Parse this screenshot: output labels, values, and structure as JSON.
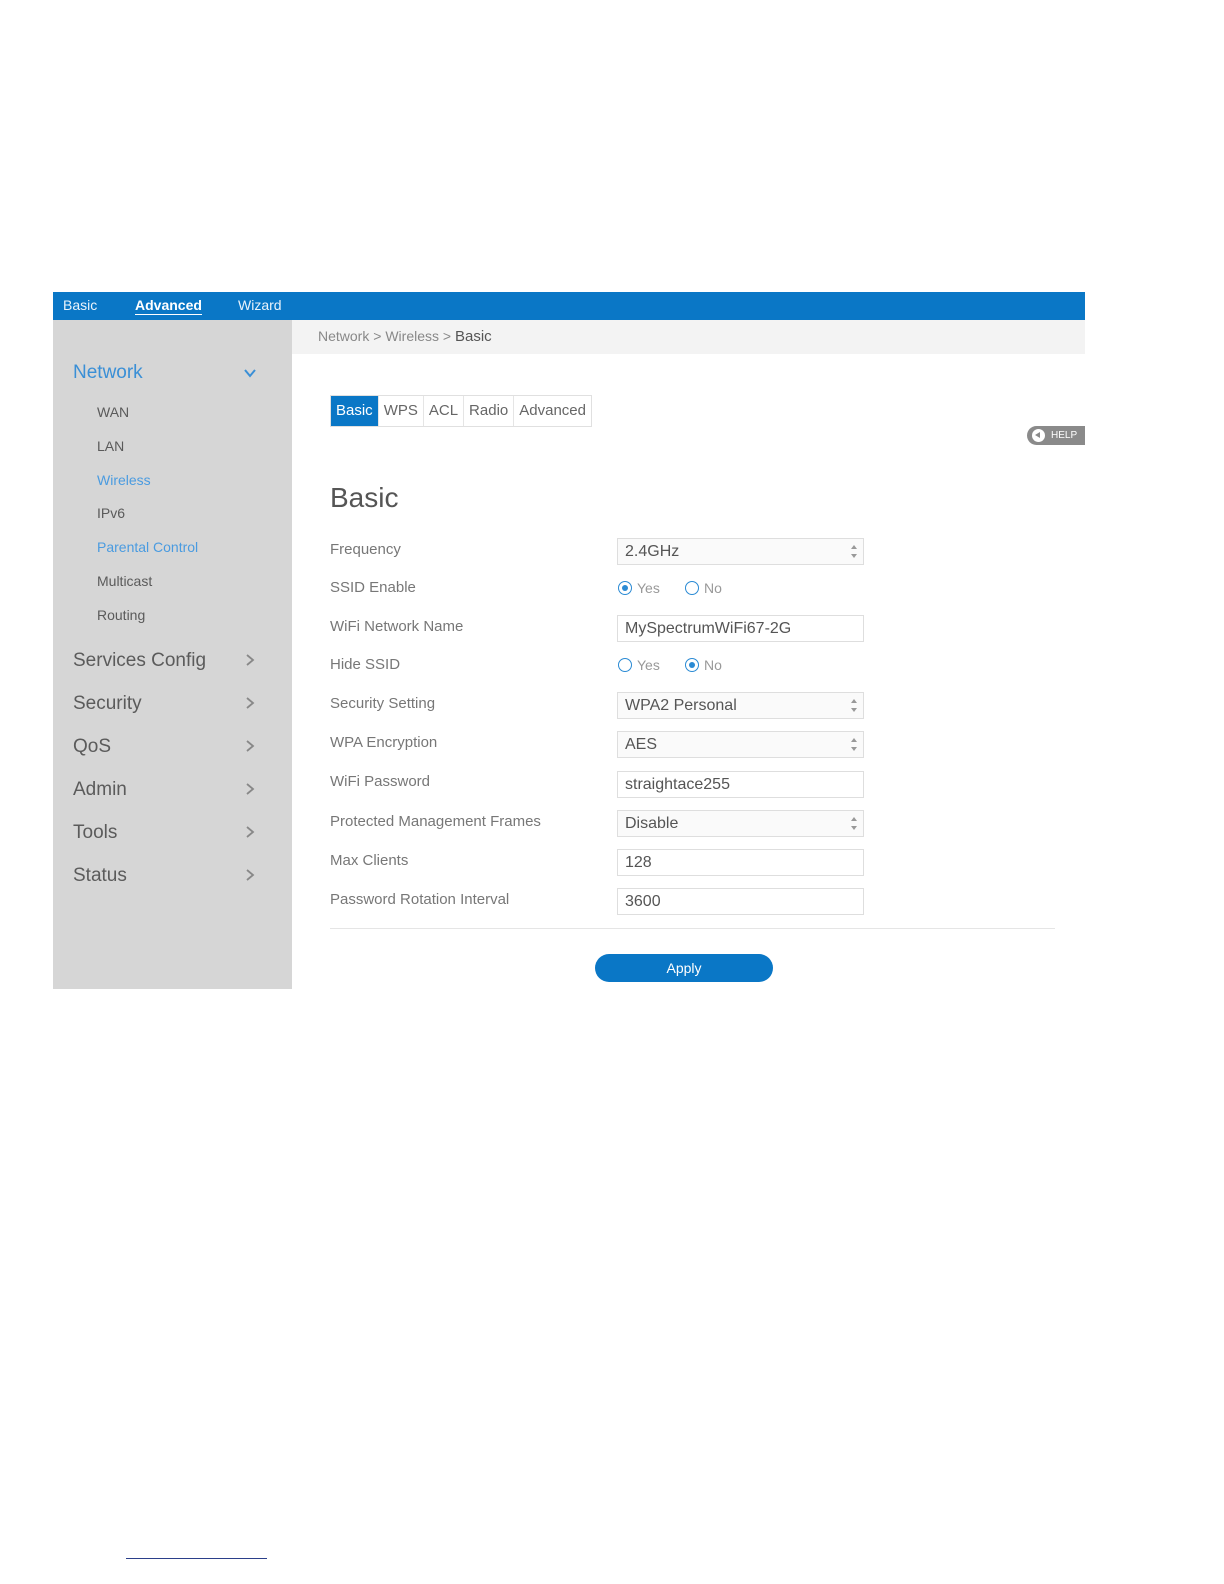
{
  "topnav": {
    "basic": "Basic",
    "advanced": "Advanced",
    "wizard": "Wizard"
  },
  "sidebar": {
    "network": "Network",
    "network_items": [
      "WAN",
      "LAN",
      "Wireless",
      "IPv6",
      "Parental Control",
      "Multicast",
      "Routing"
    ],
    "sections": [
      "Services Config",
      "Security",
      "QoS",
      "Admin",
      "Tools",
      "Status"
    ]
  },
  "breadcrumb": {
    "part1": "Network",
    "sep": ">",
    "part2": "Wireless",
    "current": "Basic"
  },
  "tabs": [
    "Basic",
    "WPS",
    "ACL",
    "Radio",
    "Advanced"
  ],
  "help_label": "HELP",
  "page_title": "Basic",
  "form": {
    "frequency": {
      "label": "Frequency",
      "value": "2.4GHz"
    },
    "ssid_enable": {
      "label": "SSID Enable",
      "yes": "Yes",
      "no": "No",
      "selected": "Yes"
    },
    "network_name": {
      "label": "WiFi Network Name",
      "value": "MySpectrumWiFi67-2G"
    },
    "hide_ssid": {
      "label": "Hide SSID",
      "yes": "Yes",
      "no": "No",
      "selected": "No"
    },
    "security_setting": {
      "label": "Security Setting",
      "value": "WPA2 Personal"
    },
    "wpa_encryption": {
      "label": "WPA Encryption",
      "value": "AES"
    },
    "wifi_password": {
      "label": "WiFi Password",
      "value": "straightace255"
    },
    "pmf": {
      "label": "Protected Management Frames",
      "value": "Disable"
    },
    "max_clients": {
      "label": "Max Clients",
      "value": "128"
    },
    "rotation_interval": {
      "label": "Password Rotation Interval",
      "value": "3600"
    }
  },
  "apply_label": "Apply",
  "colors": {
    "brand": "#0a77c6",
    "sidebar_bg": "#d6d6d6",
    "link": "#4a9be0"
  }
}
